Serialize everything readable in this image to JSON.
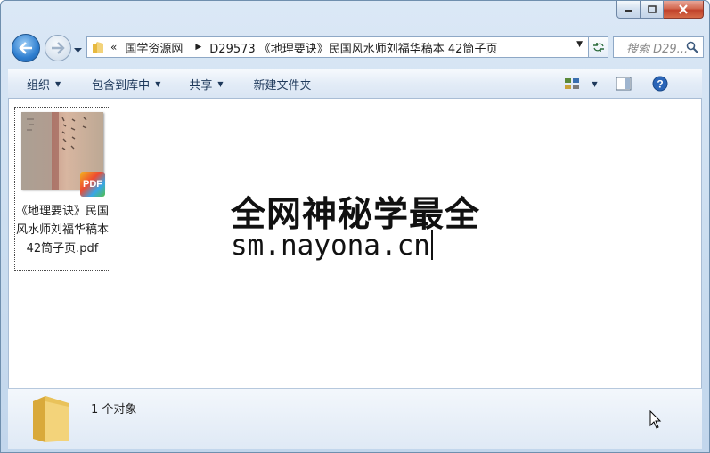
{
  "window": {
    "caption": {
      "minimize": "minimize",
      "maximize": "maximize",
      "close": "close"
    }
  },
  "nav": {
    "overflow": "«",
    "breadcrumb": [
      "国学资源网",
      "D29573 《地理要诀》民国风水师刘福华稿本 42筒子页"
    ],
    "search_placeholder": "搜索 D29..."
  },
  "toolbar": {
    "organize": "组织",
    "include_library": "包含到库中",
    "share": "共享",
    "new_folder": "新建文件夹"
  },
  "files": [
    {
      "name": "《地理要诀》民国风水师刘福华稿本 42筒子页.pdf",
      "badge": "PDF"
    }
  ],
  "watermark": {
    "line1": "全网神秘学最全",
    "line2": "sm.nayona.cn"
  },
  "details": {
    "status": "1 个对象"
  },
  "colors": {
    "accent": "#2f7fd0",
    "close": "#c0412a"
  }
}
